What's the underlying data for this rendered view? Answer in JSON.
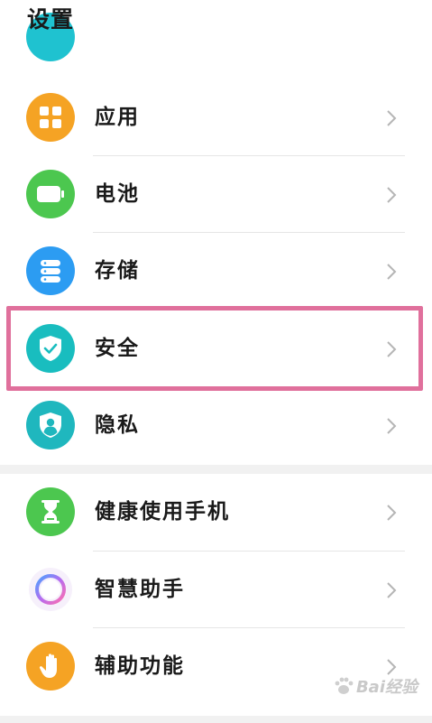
{
  "header": {
    "title": "设置"
  },
  "groups": [
    {
      "items": [
        {
          "label": "应用",
          "icon": "apps-grid-icon",
          "color": "#f5a324"
        },
        {
          "label": "电池",
          "icon": "battery-icon",
          "color": "#4cc74f"
        },
        {
          "label": "存储",
          "icon": "storage-icon",
          "color": "#2c9cf2"
        },
        {
          "label": "安全",
          "icon": "security-shield-icon",
          "color": "#19bdbf",
          "highlighted": true
        },
        {
          "label": "隐私",
          "icon": "privacy-icon",
          "color": "#1fb7be"
        }
      ]
    },
    {
      "items": [
        {
          "label": "健康使用手机",
          "icon": "hourglass-icon",
          "color": "#4cc74f"
        },
        {
          "label": "智慧助手",
          "icon": "smart-assistant-icon",
          "color": "#b56cf0"
        },
        {
          "label": "辅助功能",
          "icon": "accessibility-hand-icon",
          "color": "#f5a324"
        }
      ]
    }
  ],
  "highlight_color": "#e0709c",
  "watermark": {
    "text": "Bai经验"
  }
}
